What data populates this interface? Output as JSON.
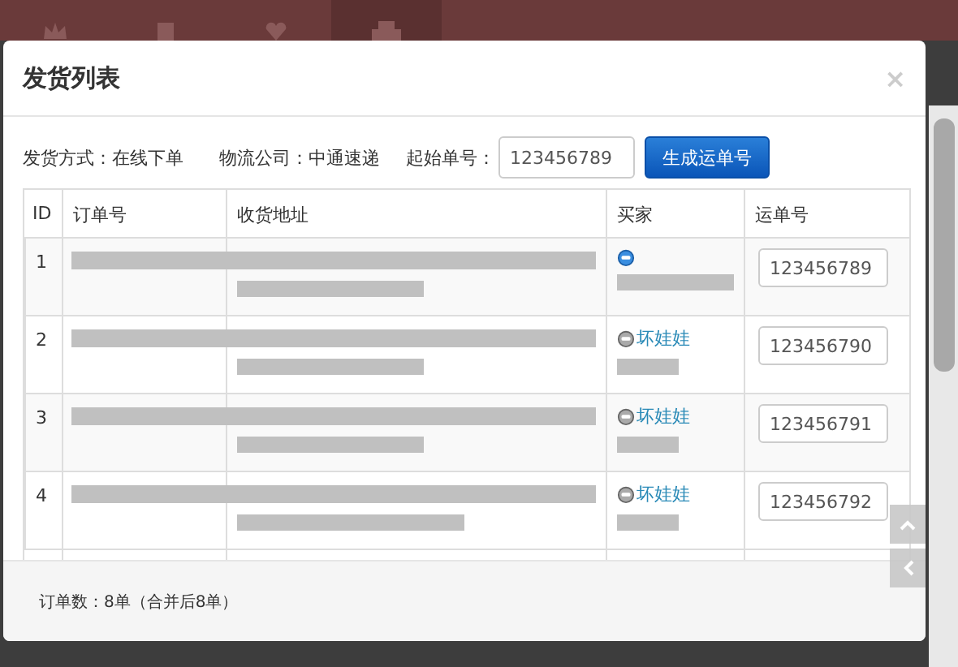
{
  "modal": {
    "title": "发货列表",
    "close": "×"
  },
  "form": {
    "ship_method": "发货方式：在线下单",
    "logistics": "物流公司：中通速递",
    "start_label": "起始单号：",
    "start_value": "123456789",
    "generate_button": "生成运单号"
  },
  "table": {
    "columns": [
      "ID",
      "订单号",
      "收货地址",
      "买家",
      "运单号"
    ],
    "rows": [
      {
        "id": "1",
        "buyer_online": true,
        "waybill": "123456789"
      },
      {
        "id": "2",
        "buyer_online": false,
        "buyer": "坏娃娃",
        "waybill": "123456790"
      },
      {
        "id": "3",
        "buyer_online": false,
        "buyer": "坏娃娃",
        "waybill": "123456791"
      },
      {
        "id": "4",
        "buyer_online": false,
        "buyer": "坏娃娃",
        "waybill": "123456792"
      }
    ]
  },
  "footer": {
    "summary": "订单数：8单（合并后8单）"
  }
}
